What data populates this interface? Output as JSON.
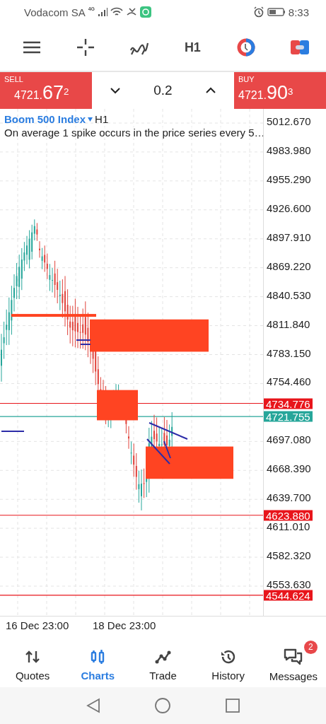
{
  "status_bar": {
    "carrier": "Vodacom SA",
    "network": "4G",
    "time": "8:33"
  },
  "toolbar": {
    "timeframe": "H1"
  },
  "trade_bar": {
    "sell": {
      "label": "SELL",
      "price_main": "4721.",
      "price_big": "67",
      "price_sup": "2"
    },
    "volume": "0.2",
    "buy": {
      "label": "BUY",
      "price_main": "4721.",
      "price_big": "90",
      "price_sup": "3"
    }
  },
  "chart": {
    "symbol": "Boom 500 Index",
    "timeframe": "H1",
    "description": "On average 1 spike occurs in the price series every 5…",
    "price_ticks": [
      "5012.670",
      "4983.980",
      "4955.290",
      "4926.600",
      "4897.910",
      "4869.220",
      "4840.530",
      "4811.840",
      "4783.150",
      "4754.460",
      "4697.080",
      "4668.390",
      "4639.700",
      "4611.010",
      "4582.320",
      "4553.630"
    ],
    "price_lines": [
      {
        "label": "4734.776",
        "color": "#e8151b"
      },
      {
        "label": "4721.755",
        "color": "#26a69a"
      },
      {
        "label": "4623.880",
        "color": "#e8151b"
      },
      {
        "label": "4544.624",
        "color": "#e8151b"
      }
    ],
    "time_labels": [
      "16 Dec 23:00",
      "18 Dec 23:00"
    ]
  },
  "bottom_nav": [
    {
      "label": "Quotes",
      "kind": "quotes",
      "selected": false
    },
    {
      "label": "Charts",
      "kind": "charts",
      "selected": true
    },
    {
      "label": "Trade",
      "kind": "trade",
      "selected": false
    },
    {
      "label": "History",
      "kind": "history",
      "selected": false
    },
    {
      "label": "Messages",
      "kind": "messages",
      "selected": false,
      "badge": "2"
    }
  ]
}
